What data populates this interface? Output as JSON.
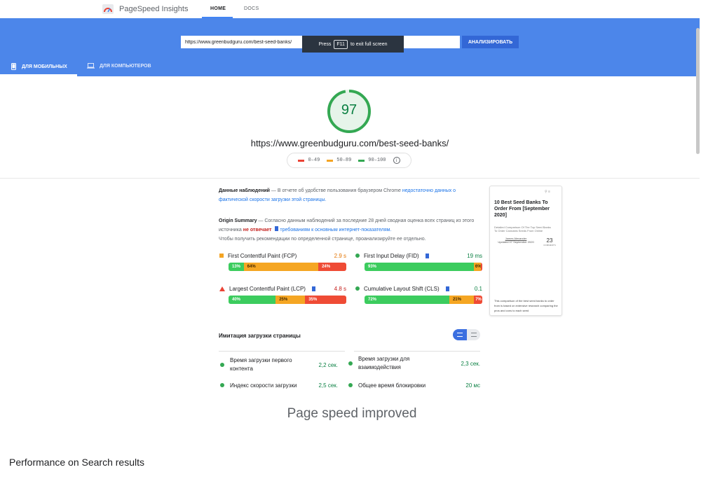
{
  "header": {
    "brand": "PageSpeed Insights",
    "nav": [
      "HOME",
      "DOCS"
    ]
  },
  "fullscreen_toast": {
    "before": "Press",
    "key": "F11",
    "after": "to exit full screen"
  },
  "search": {
    "url_value": "https://www.greenbudguru.com/best-seed-banks/",
    "analyze_label": "АНАЛИЗИРОВАТЬ"
  },
  "tabs": {
    "mobile": "ДЛЯ МОБИЛЬНЫХ",
    "desktop": "ДЛЯ КОМПЬЮТЕРОВ"
  },
  "score": {
    "value": "97",
    "fraction": 0.97,
    "url": "https://www.greenbudguru.com/best-seed-banks/"
  },
  "legend": [
    {
      "range": "0–49",
      "color": "#eb4335"
    },
    {
      "range": "50–89",
      "color": "#f4a423"
    },
    {
      "range": "90–100",
      "color": "#34a853"
    }
  ],
  "field_data": {
    "title": "Данные наблюдений",
    "text": " — В отчете об удобстве пользования браузером Chrome ",
    "link": "недостаточно данных о фактической скорости загрузки этой страницы."
  },
  "origin": {
    "title": "Origin Summary",
    "text1": " — Согласно данным наблюдений за последние 28 дней сводная оценка всех страниц из этого источника ",
    "not_meet": "не отвечает",
    "link": "требованиям к основным интернет-показателям.",
    "text2": "Чтобы получить рекомендации по определенной странице, проанализируйте ее отдельно."
  },
  "metrics": {
    "fcp": {
      "label": "First Contentful Paint (FCP)",
      "value": "2.9 s",
      "good": "13%",
      "avg": "64%",
      "poor": "24%",
      "value_color": "#e37400"
    },
    "fid": {
      "label": "First Input Delay (FID)",
      "value": "19 ms",
      "good": "93%",
      "avg": "6%",
      "poor": "1%",
      "value_color": "#0b8043"
    },
    "lcp": {
      "label": "Largest Contentful Paint (LCP)",
      "value": "4.8 s",
      "good": "40%",
      "avg": "25%",
      "poor": "35%",
      "value_color": "#c5221f"
    },
    "cls": {
      "label": "Cumulative Layout Shift (CLS)",
      "value": "0.1",
      "good": "72%",
      "avg": "21%",
      "poor": "7%",
      "value_color": "#0b8043"
    }
  },
  "lab": {
    "title": "Имитация загрузки страницы",
    "rows": [
      {
        "label": "Время загрузки первого контента",
        "value": "2,2 сек."
      },
      {
        "label": "Время загрузки для взаимодействия",
        "value": "2,3 сек."
      },
      {
        "label": "Индекс скорости загрузки",
        "value": "2,5 сек."
      },
      {
        "label": "Общее время блокировки",
        "value": "20 мс"
      }
    ]
  },
  "thumbnail": {
    "title": "10 Best Seed Banks To Order From [September 2020]",
    "subtitle": "Detailed Comparison Of The Top Seed Banks To Order Cannabis Seeds From Online",
    "author": "James Alexander",
    "updated": "Updated 07 September 2020",
    "count": "23",
    "count_label": "COMMENTS",
    "body": "This comparison of the best seed banks to order from is based on extensive research comparing the pros and cons to each seed"
  },
  "caption": "Page speed improved",
  "section_title": "Performance on Search results"
}
